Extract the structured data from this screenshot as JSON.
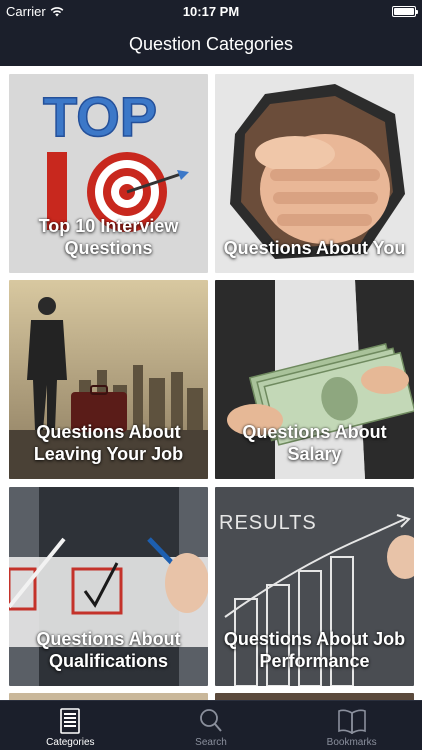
{
  "status_bar": {
    "carrier": "Carrier",
    "time": "10:17 PM"
  },
  "nav": {
    "title": "Question Categories"
  },
  "categories": [
    {
      "label": "Top 10 Interview Questions",
      "line1": "Top 10 Interview",
      "line2": "Questions",
      "art_text": "TOP"
    },
    {
      "label": "Questions About You",
      "line1": "Questions About You",
      "line2": ""
    },
    {
      "label": "Questions About Leaving Your Job",
      "line1": "Questions About",
      "line2": "Leaving Your Job"
    },
    {
      "label": "Questions About Salary",
      "line1": "Questions About",
      "line2": "Salary"
    },
    {
      "label": "Questions About Qualifications",
      "line1": "Questions About",
      "line2": "Qualifications"
    },
    {
      "label": "Questions About Job Performance",
      "line1": "Questions About Job",
      "line2": "Performance",
      "art_text": "RESULTS"
    }
  ],
  "tabs": [
    {
      "label": "Categories",
      "icon": "document-icon",
      "active": true
    },
    {
      "label": "Search",
      "icon": "search-icon",
      "active": false
    },
    {
      "label": "Bookmarks",
      "icon": "book-icon",
      "active": false
    }
  ],
  "colors": {
    "bar_background": "#1b1f2b",
    "active_tab": "#ffffff",
    "inactive_tab": "#8a8f9c"
  }
}
